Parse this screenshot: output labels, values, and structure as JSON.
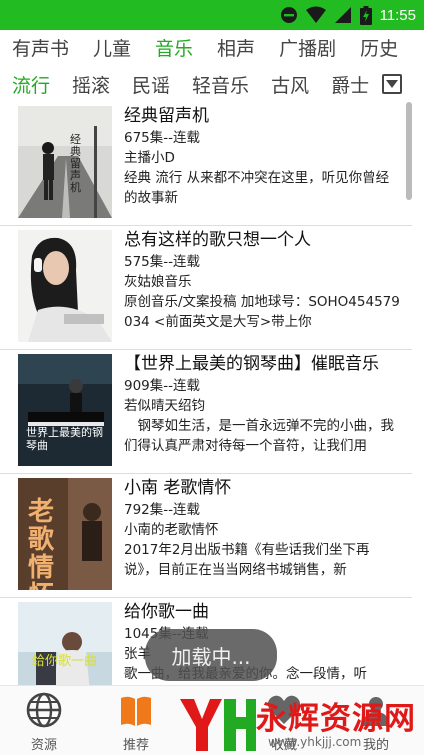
{
  "status_bar": {
    "time": "11:55",
    "bg_color": "#22bb22"
  },
  "categories": [
    {
      "label": "有声书",
      "active": false
    },
    {
      "label": "儿童",
      "active": false
    },
    {
      "label": "音乐",
      "active": true
    },
    {
      "label": "相声",
      "active": false
    },
    {
      "label": "广播剧",
      "active": false
    },
    {
      "label": "历史",
      "active": false
    }
  ],
  "subcategories": [
    {
      "label": "流行",
      "active": true
    },
    {
      "label": "摇滚",
      "active": false
    },
    {
      "label": "民谣",
      "active": false
    },
    {
      "label": "轻音乐",
      "active": false
    },
    {
      "label": "古风",
      "active": false
    },
    {
      "label": "爵士",
      "active": false
    }
  ],
  "accent_color": "#22aa22",
  "items": [
    {
      "title": "经典留声机",
      "episodes": "675集--连载",
      "host": "主播小D",
      "description": "经典 流行 从来都不冲突在这里，听见你曾经的故事新",
      "cover_text": "经典留声机"
    },
    {
      "title": "总有这样的歌只想一个人",
      "episodes": "575集--连载",
      "host": "灰姑娘音乐",
      "description": "原创音乐/文案投稿 加地球号：SOHO454579034 <前面英文是大写>带上你",
      "cover_text": ""
    },
    {
      "title": "【世界上最美的钢琴曲】催眠音乐",
      "episodes": "909集--连载",
      "host": "若似晴天绍钧",
      "description": "　钢琴如生活，是一首永远弹不完的小曲，我们得认真严肃对待每一个音符，让我们用",
      "cover_text": "世界上最美的钢琴曲"
    },
    {
      "title": "小南 老歌情怀",
      "episodes": "792集--连载",
      "host": "小南的老歌情怀",
      "description": "2017年2月出版书籍《有些话我们坐下再说》，目前正在当当网络书城销售，新",
      "cover_text": "老歌情怀"
    },
    {
      "title": "给你歌一曲",
      "episodes": "1045集--连载",
      "host": "张羊",
      "description": "歌一曲，给我最亲爱的你。念一段情，听",
      "cover_text": "给你歌一曲"
    }
  ],
  "toast": {
    "text": "加载中..."
  },
  "bottom_nav": [
    {
      "label": "资源",
      "icon": "globe-icon"
    },
    {
      "label": "推荐",
      "icon": "book-icon"
    },
    {
      "label": "收藏",
      "icon": "heart-icon"
    },
    {
      "label": "我的",
      "icon": "person-icon"
    }
  ],
  "watermark": {
    "text": "永辉资源网",
    "url": "www.yhkjjj.com"
  }
}
